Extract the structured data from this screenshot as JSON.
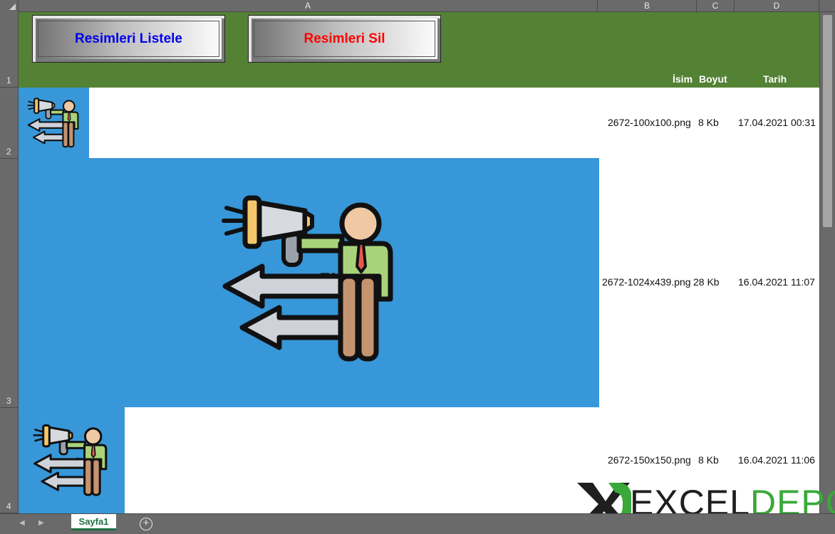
{
  "column_headers": [
    "A",
    "B",
    "C",
    "D"
  ],
  "row_headers": [
    "1",
    "2",
    "3",
    "4"
  ],
  "buttons": {
    "list_label": "Resimleri Listele",
    "delete_label": "Resimleri Sil"
  },
  "table": {
    "headers": {
      "name": "İsim",
      "size": "Boyut",
      "date": "Tarih"
    },
    "rows": [
      {
        "name": "2672-100x100.png",
        "size": "8 Kb",
        "date": "17.04.2021 00:31"
      },
      {
        "name": "2672-1024x439.png",
        "size": "28 Kb",
        "date": "16.04.2021 11:07"
      },
      {
        "name": "2672-150x150.png",
        "size": "8 Kb",
        "date": "16.04.2021 11:06"
      }
    ]
  },
  "images": [
    {
      "icon": "megaphone-announcer-icon"
    },
    {
      "icon": "megaphone-announcer-icon"
    },
    {
      "icon": "megaphone-announcer-icon"
    }
  ],
  "sheet_tabs": [
    "Sayfa1"
  ],
  "watermark": {
    "part1": "EXCEL",
    "part2": "DEPO"
  },
  "colors": {
    "header_green": "#548235",
    "image_blue": "#3797d9",
    "list_button_text": "#0000ee",
    "delete_button_text": "#ff0000",
    "tab_green": "#1e7145",
    "logo_green": "#3aa93a"
  }
}
